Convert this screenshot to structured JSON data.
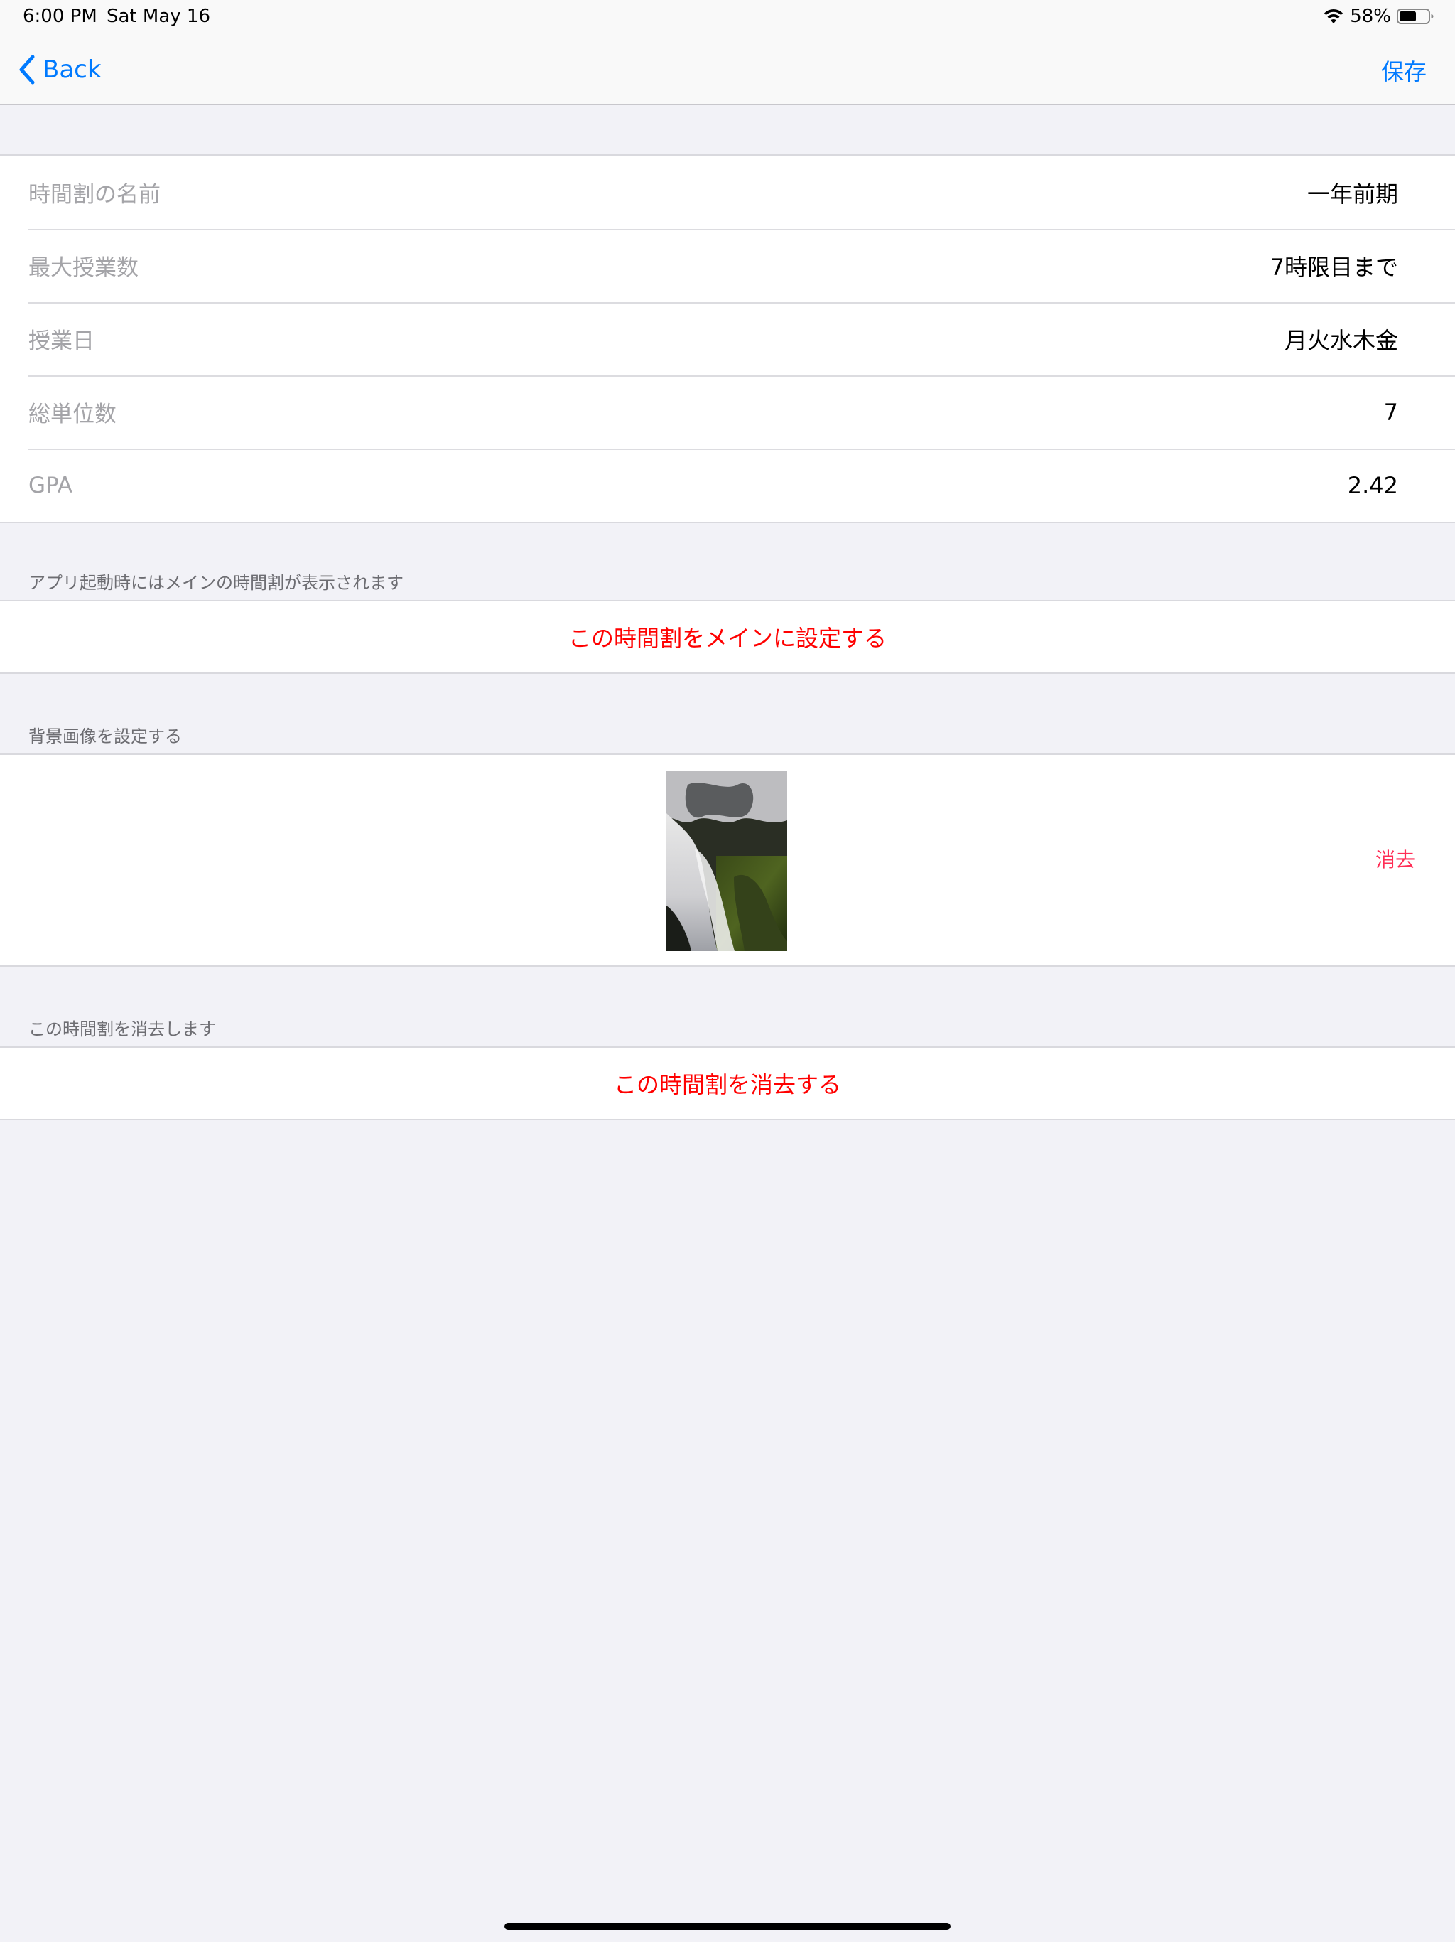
{
  "status_bar": {
    "time": "6:00 PM",
    "date": "Sat May 16",
    "battery_percent": "58%",
    "battery_level": 0.58,
    "icons": [
      "wifi-icon",
      "battery-icon"
    ]
  },
  "nav": {
    "back_label": "Back",
    "save_label": "保存",
    "icons": [
      "chevron-left-icon"
    ],
    "accent_color": "#007aff"
  },
  "settings": {
    "rows": [
      {
        "label": "時間割の名前",
        "value": "一年前期"
      },
      {
        "label": "最大授業数",
        "value": "7時限目まで"
      },
      {
        "label": "授業日",
        "value": "月火水木金"
      },
      {
        "label": "総単位数",
        "value": "7"
      },
      {
        "label": "GPA",
        "value": "2.42"
      }
    ]
  },
  "main_section": {
    "header": "アプリ起動時にはメインの時間割が表示されます",
    "action_label": "この時間割をメインに設定する"
  },
  "background_section": {
    "header": "背景画像を設定する",
    "delete_label": "消去",
    "image": "waterfall-thumbnail"
  },
  "delete_section": {
    "header": "この時間割を消去します",
    "action_label": "この時間割を消去する"
  },
  "colors": {
    "destructive": "#ff0000",
    "delete_link": "#ff2d55",
    "background": "#f2f2f7"
  }
}
